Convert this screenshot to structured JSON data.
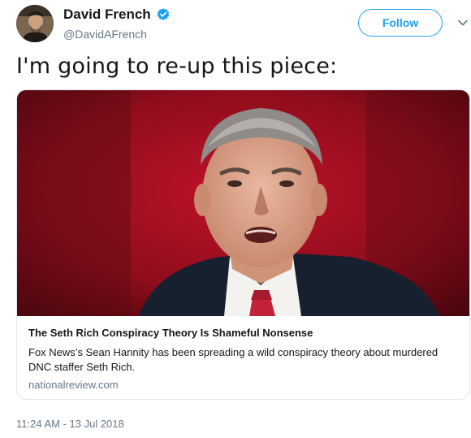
{
  "user": {
    "display_name": "David French",
    "handle": "@DavidAFrench",
    "verified": true
  },
  "follow_label": "Follow",
  "tweet_text": "I'm going to re-up this piece:",
  "card": {
    "title": "The Seth Rich Conspiracy Theory Is Shameful Nonsense",
    "description": "Fox News’s Sean Hannity has been spreading a wild conspiracy theory about murdered DNC staffer Seth Rich.",
    "domain": "nationalreview.com"
  },
  "timestamp": "11:24 AM - 13 Jul 2018",
  "colors": {
    "accent": "#1da1f2",
    "text": "#14171a",
    "secondary_text": "#657786",
    "border": "#e1e8ed"
  }
}
